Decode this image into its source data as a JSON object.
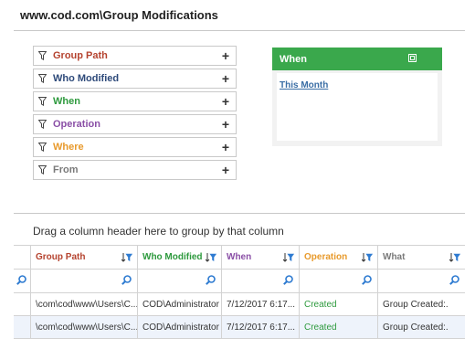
{
  "page": {
    "title": "www.cod.com\\Group Modifications"
  },
  "colors": {
    "group_path": "#b5432f",
    "who_modified": "#2e4a7a",
    "when": "#2e9a3e",
    "operation": "#8a4fa6",
    "where": "#e89a2c",
    "from": "#7a7a7a",
    "when_header": "#3aa84c",
    "link": "#3a6ea5",
    "filter_icon": "#2e7bd1"
  },
  "filters": [
    {
      "label": "Group Path",
      "action": "+",
      "icon": "filter-funnel-icon"
    },
    {
      "label": "Who Modified",
      "action": "+",
      "icon": "filter-funnel-icon"
    },
    {
      "label": "When",
      "action": "+",
      "icon": "filter-funnel-icon"
    },
    {
      "label": "Operation",
      "action": "+",
      "icon": "filter-funnel-icon"
    },
    {
      "label": "Where",
      "action": "+",
      "icon": "filter-funnel-icon"
    },
    {
      "label": "From",
      "action": "+",
      "icon": "filter-funnel-icon"
    }
  ],
  "when_panel": {
    "header": "When",
    "link": "This Month",
    "icon": "minimize-icon"
  },
  "grid": {
    "group_hint": "Drag a column header here to group by that column",
    "columns": [
      "Group Path",
      "Who Modified",
      "When",
      "Operation",
      "What"
    ],
    "rows": [
      [
        "\\com\\cod\\www\\Users\\C...",
        "COD\\Administrator",
        "7/12/2017 6:17...",
        "Created",
        "Group Created:."
      ],
      [
        "\\com\\cod\\www\\Users\\C...",
        "COD\\Administrator",
        "7/12/2017 6:17...",
        "Created",
        "Group Created:."
      ]
    ]
  }
}
